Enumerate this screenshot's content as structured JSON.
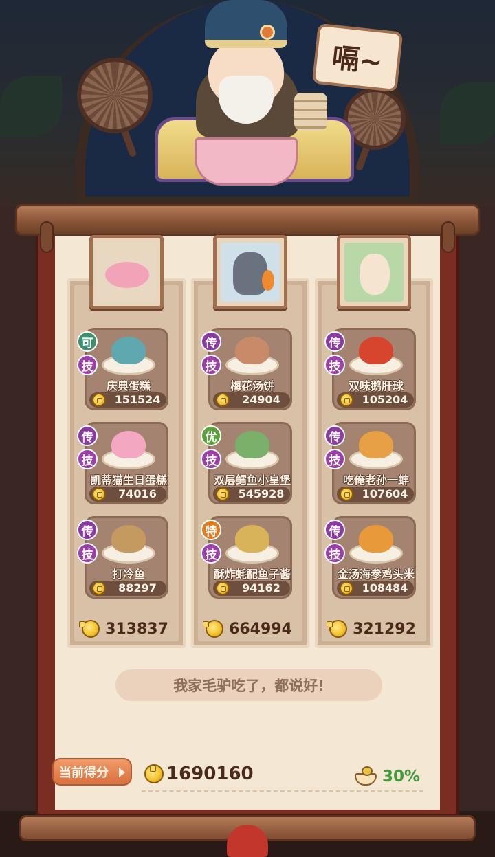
{
  "speech_bubble": "嗝~",
  "columns": [
    {
      "portrait": "pink-dolphin",
      "dishes": [
        {
          "rarity": "可",
          "rarity_color": "#3e8f6e",
          "skill": "技",
          "name": "庆典蛋糕",
          "score": "151524",
          "food_color": "#5fa8b0"
        },
        {
          "rarity": "传",
          "rarity_color": "#8a3aa0",
          "skill": "技",
          "name": "凯蒂猫生日蛋糕",
          "score": "74016",
          "food_color": "#f4a7c0"
        },
        {
          "rarity": "传",
          "rarity_color": "#8a3aa0",
          "skill": "技",
          "name": "打冷鱼",
          "score": "88297",
          "food_color": "#c49a60"
        }
      ],
      "total": "313837"
    },
    {
      "portrait": "wolf-with-carrot",
      "dishes": [
        {
          "rarity": "传",
          "rarity_color": "#8a3aa0",
          "skill": "技",
          "name": "梅花汤饼",
          "score": "24904",
          "food_color": "#c98a6a"
        },
        {
          "rarity": "优",
          "rarity_color": "#5aa33a",
          "skill": "技",
          "name": "双层鳕鱼小皇堡",
          "score": "545928",
          "food_color": "#7ab06a"
        },
        {
          "rarity": "特",
          "rarity_color": "#e07a1e",
          "skill": "技",
          "name": "酥炸蚝配鱼子酱",
          "score": "94162",
          "food_color": "#d9b35a"
        }
      ],
      "total": "664994"
    },
    {
      "portrait": "rabbit-girl",
      "dishes": [
        {
          "rarity": "传",
          "rarity_color": "#8a3aa0",
          "skill": "技",
          "name": "双味鹅肝球",
          "score": "105204",
          "food_color": "#d8452e"
        },
        {
          "rarity": "传",
          "rarity_color": "#8a3aa0",
          "skill": "技",
          "name": "吃俺老孙一蚌",
          "score": "107604",
          "food_color": "#e8a046"
        },
        {
          "rarity": "传",
          "rarity_color": "#8a3aa0",
          "skill": "技",
          "name": "金汤海参鸡头米",
          "score": "108484",
          "food_color": "#e89a3a"
        }
      ],
      "total": "321292"
    }
  ],
  "tagline": "我家毛驴吃了，都说好!",
  "score_label": "当前得分",
  "total_score": "1690160",
  "bonus_percent": "30%",
  "colors": {
    "paper": "#f4e7d3",
    "frame": "#7a2e22",
    "skill_badge": "#9c3fa8",
    "bonus_green": "#3f9a3a"
  }
}
